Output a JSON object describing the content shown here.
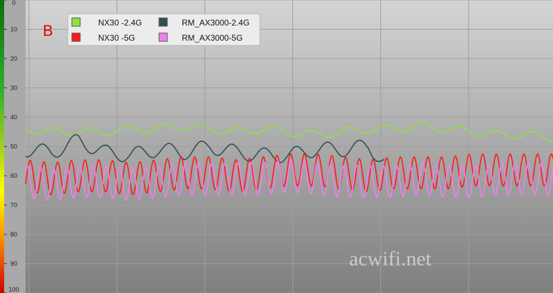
{
  "panel_label": "B",
  "watermark": "acwifi.net",
  "chart_data": {
    "type": "line",
    "ylim": [
      0,
      100
    ],
    "y_inverted": true,
    "y_ticks": [
      "0",
      "10",
      "20",
      "30",
      "40",
      "50",
      "60",
      "70",
      "80",
      "90",
      "100"
    ],
    "grid": true,
    "legend_position": "top-left",
    "series": [
      {
        "name": "NX30 -2.4G",
        "color": "#8ee33c",
        "x": [
          0,
          5,
          10,
          15,
          20,
          25,
          30,
          35,
          40,
          45,
          50,
          55,
          60,
          65,
          70,
          75,
          80,
          85,
          90,
          95,
          100
        ],
        "values": [
          44,
          45,
          45,
          45,
          44,
          44,
          43,
          44,
          45,
          44,
          45,
          46,
          45,
          44,
          44,
          43,
          44,
          45,
          46,
          46,
          47
        ]
      },
      {
        "name": "RM_AX3000-2.4G",
        "color": "#2f4f4f",
        "x": [
          0,
          5,
          10,
          15,
          20,
          25,
          30,
          35,
          40,
          45,
          50,
          55,
          60,
          65,
          68
        ],
        "values": [
          51,
          52,
          48,
          52,
          53,
          51,
          52,
          50,
          52,
          53,
          53,
          51,
          51,
          50,
          55
        ]
      },
      {
        "name": "NX30 -5G",
        "color": "#ff1a1a",
        "x": [
          0,
          5,
          10,
          15,
          20,
          25,
          30,
          35,
          40,
          45,
          50,
          55,
          60,
          65,
          70,
          75,
          80,
          85,
          90,
          95,
          100
        ],
        "values": [
          60,
          61,
          60,
          60,
          61,
          60,
          59,
          59,
          60,
          59,
          58,
          58,
          59,
          60,
          59,
          59,
          59,
          58,
          58,
          58,
          58
        ]
      },
      {
        "name": "RM_AX3000-5G",
        "color": "#ee82ee",
        "x": [
          0,
          5,
          10,
          15,
          20,
          25,
          30,
          35,
          40,
          45,
          50,
          55,
          60,
          65,
          70,
          75,
          80,
          85,
          90,
          95,
          100
        ],
        "values": [
          62,
          63,
          62,
          62,
          63,
          62,
          61,
          61,
          61,
          61,
          60,
          61,
          62,
          62,
          62,
          61,
          62,
          62,
          61,
          61,
          61
        ]
      }
    ]
  }
}
